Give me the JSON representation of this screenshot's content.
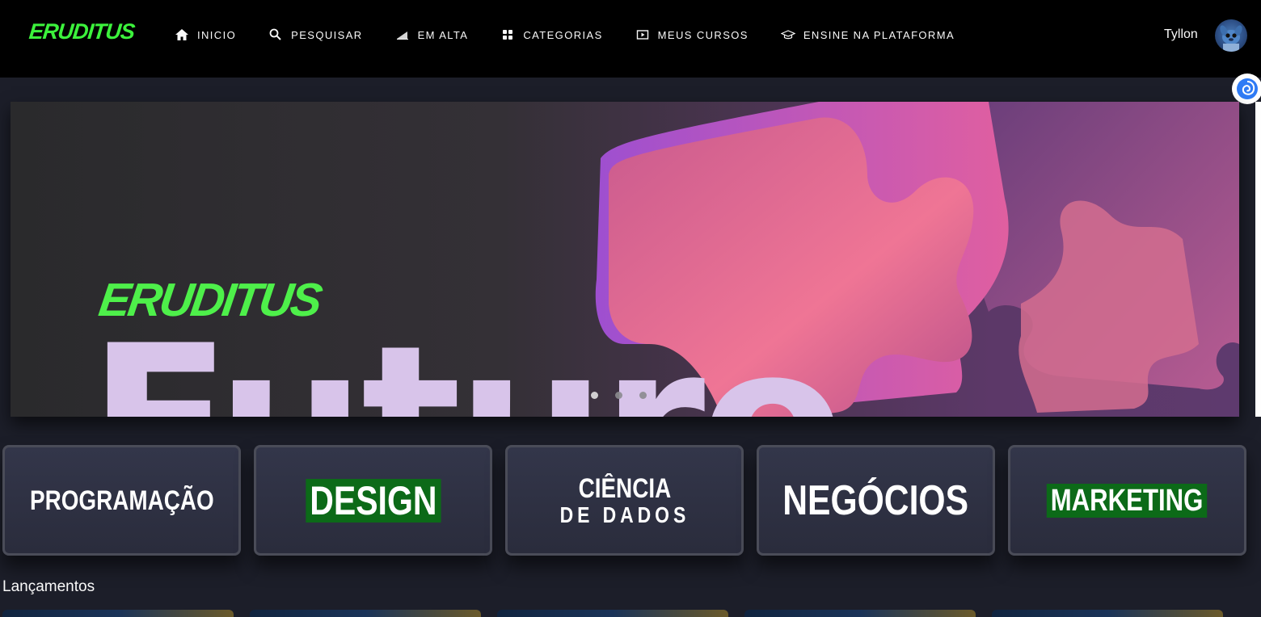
{
  "header": {
    "logo": "ERUDITUS",
    "nav": [
      {
        "label": "INICIO",
        "icon": "home-icon"
      },
      {
        "label": "PESQUISAR",
        "icon": "search-icon"
      },
      {
        "label": "EM ALTA",
        "icon": "trending-icon"
      },
      {
        "label": "CATEGORIAS",
        "icon": "grid-icon"
      },
      {
        "label": "MEUS CURSOS",
        "icon": "play-list-icon"
      },
      {
        "label": "ENSINE NA PLATAFORMA",
        "icon": "graduation-cap-icon"
      }
    ],
    "user_name": "Tyllon",
    "avatar_icon": "user-avatar"
  },
  "hero": {
    "logo": "ERUDITUS",
    "big_text": "Futuro",
    "active_slide": 1,
    "slide_count": 3
  },
  "categories": [
    {
      "label": "PROGRAMAÇÃO",
      "highlight": false
    },
    {
      "label": "DESIGN",
      "highlight": true
    },
    {
      "label": "CIÊNCIA",
      "sub": "DE DADOS",
      "highlight": false
    },
    {
      "label": "NEGÓCIOS",
      "highlight": false
    },
    {
      "label": "MARKETING",
      "highlight": true
    }
  ],
  "sections": {
    "releases_title": "Lançamentos"
  },
  "colors": {
    "brand_green": "#3cf23c",
    "highlight_green": "#0c6a18",
    "background": "#1c1e29",
    "header": "#000000"
  }
}
